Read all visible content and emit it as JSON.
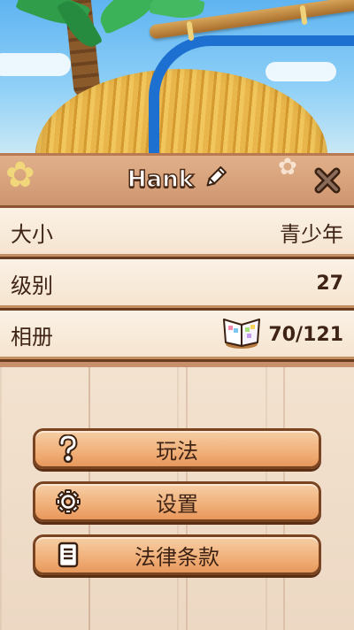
{
  "profile": {
    "name": "Hank"
  },
  "info_rows": [
    {
      "label": "大小",
      "value": "青少年"
    },
    {
      "label": "级别",
      "value": "27"
    },
    {
      "label": "相册",
      "value": "70/121"
    }
  ],
  "buttons": [
    {
      "label": "玩法",
      "icon": "question-mark-icon"
    },
    {
      "label": "设置",
      "icon": "gear-icon"
    },
    {
      "label": "法律条款",
      "icon": "document-icon"
    }
  ],
  "colors": {
    "header": "#d7a07a",
    "row_bg": "#f8ebdc",
    "button": "#f1b27c",
    "outline": "#6a3d21",
    "hose": "#1d6fd0"
  }
}
